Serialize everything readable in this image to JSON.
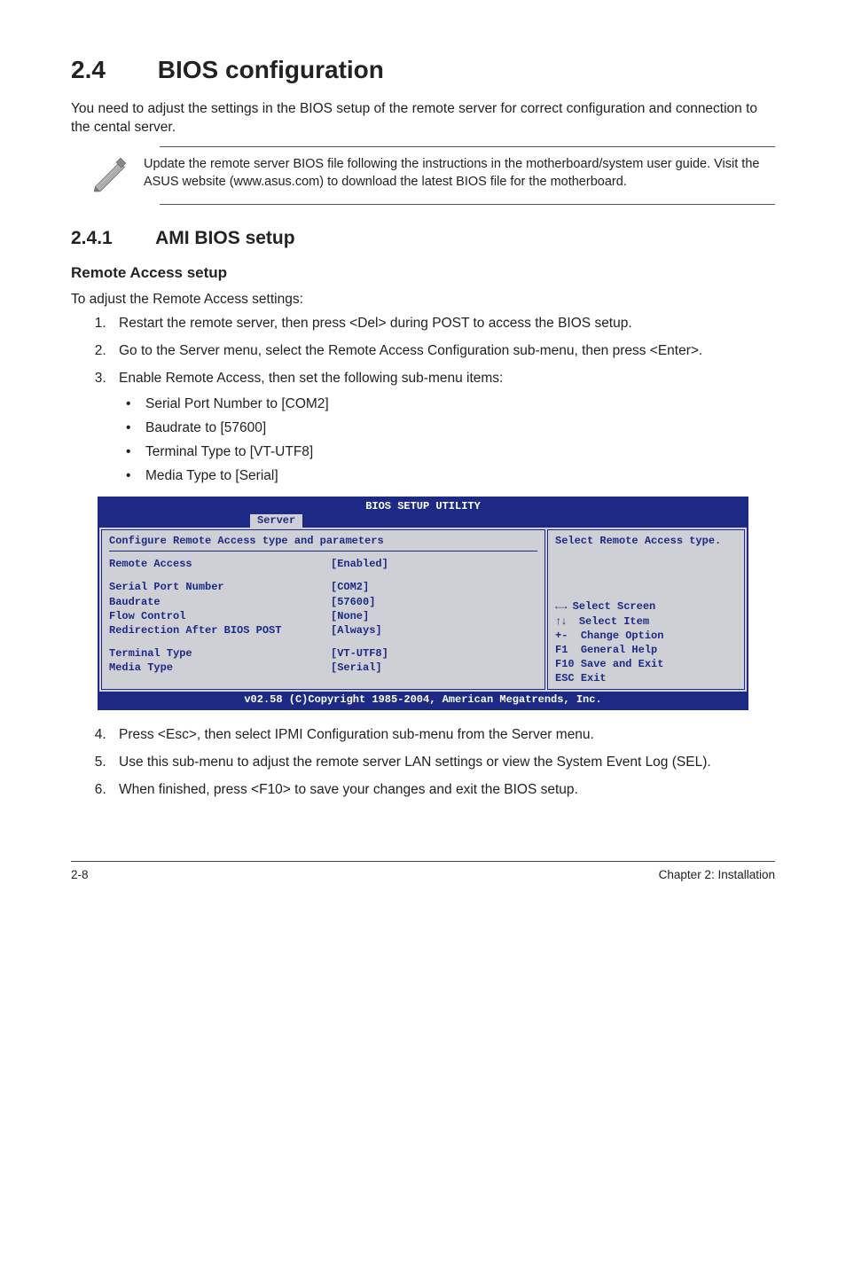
{
  "section": {
    "number": "2.4",
    "title": "BIOS configuration",
    "intro": "You need to adjust the settings in the BIOS setup of the remote server for correct configuration and connection to the cental server.",
    "note": "Update the remote server BIOS file following the instructions in the motherboard/system user guide. Visit the ASUS website (www.asus.com) to download the latest BIOS file for the motherboard."
  },
  "subsection": {
    "number": "2.4.1",
    "title": "AMI BIOS setup"
  },
  "remoteAccess": {
    "heading": "Remote Access setup",
    "lead": "To adjust the Remote Access settings:",
    "steps": {
      "s1": "Restart the remote server, then press <Del> during POST to access the BIOS setup.",
      "s2": "Go to the Server menu, select the Remote Access Configuration sub-menu, then press <Enter>.",
      "s3": "Enable Remote Access, then set the following sub-menu items:",
      "s4": "Press <Esc>, then select IPMI Configuration sub-menu from the Server menu.",
      "s5": "Use this sub-menu to adjust the remote server LAN settings or view the System Event Log (SEL).",
      "s6": "When finished, press <F10> to save your changes and exit the BIOS setup."
    },
    "bullets": {
      "b1": "Serial Port Number to [COM2]",
      "b2": "Baudrate to [57600]",
      "b3": "Terminal Type to [VT-UTF8]",
      "b4": "Media Type to [Serial]"
    }
  },
  "bios": {
    "title": "BIOS SETUP UTILITY",
    "tab": "Server",
    "panelHeading": "Configure Remote Access type and parameters",
    "rows": {
      "remoteAccess": {
        "label": "Remote Access",
        "value": "[Enabled]"
      },
      "serialPort": {
        "label": "Serial Port Number",
        "value": "[COM2]"
      },
      "baudrate": {
        "label": "Baudrate",
        "value": "[57600]"
      },
      "flowControl": {
        "label": "Flow Control",
        "value": "[None]"
      },
      "redirection": {
        "label": "Redirection After BIOS POST",
        "value": "[Always]"
      },
      "terminalType": {
        "label": "Terminal Type",
        "value": "[VT-UTF8]"
      },
      "mediaType": {
        "label": "Media Type",
        "value": "[Serial]"
      }
    },
    "sideHelp": "Select Remote Access type.",
    "keys": {
      "selectScreen": "Select Screen",
      "selectItem": "Select Item",
      "changeOption": "Change Option",
      "generalHelp": "General Help",
      "saveExit": "Save and Exit",
      "exit": "Exit",
      "k_lr": "←→",
      "k_ud": "↑↓",
      "k_pm": "+-",
      "k_f1": "F1",
      "k_f10": "F10",
      "k_esc": "ESC"
    },
    "footer": "v02.58 (C)Copyright 1985-2004, American Megatrends, Inc."
  },
  "footer": {
    "left": "2-8",
    "right": "Chapter 2: Installation"
  }
}
